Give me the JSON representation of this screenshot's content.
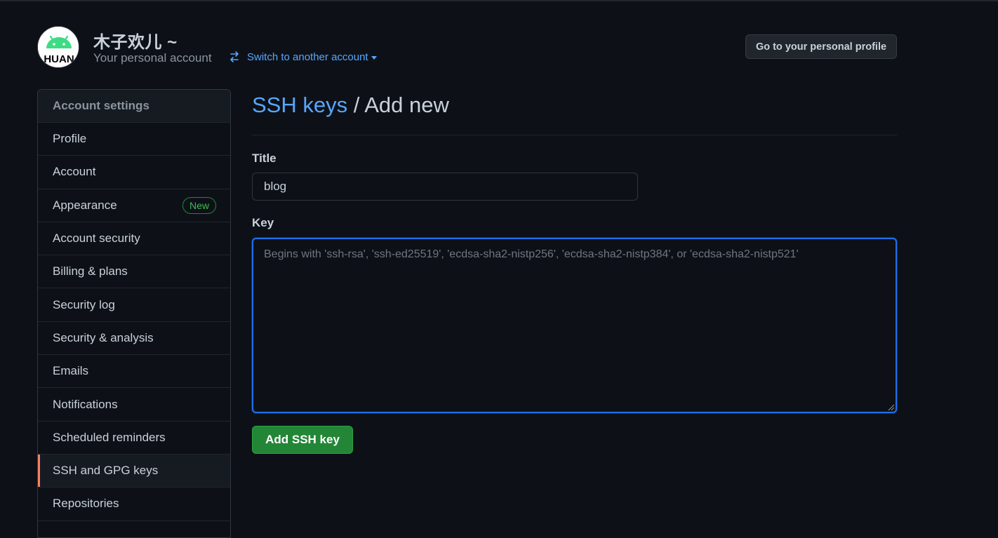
{
  "account": {
    "avatar_text": "HUAN",
    "name": "木子欢儿 ~",
    "subtitle": "Your personal account",
    "switch_label": "Switch to another account",
    "profile_button": "Go to your personal profile"
  },
  "sidebar": {
    "heading": "Account settings",
    "items": [
      {
        "label": "Profile"
      },
      {
        "label": "Account"
      },
      {
        "label": "Appearance",
        "badge": "New"
      },
      {
        "label": "Account security"
      },
      {
        "label": "Billing & plans"
      },
      {
        "label": "Security log"
      },
      {
        "label": "Security & analysis"
      },
      {
        "label": "Emails"
      },
      {
        "label": "Notifications"
      },
      {
        "label": "Scheduled reminders"
      },
      {
        "label": "SSH and GPG keys",
        "selected": true
      },
      {
        "label": "Repositories"
      }
    ]
  },
  "main": {
    "breadcrumb_link": "SSH keys",
    "breadcrumb_rest": " / Add new",
    "title_label": "Title",
    "title_value": "blog",
    "key_label": "Key",
    "key_placeholder": "Begins with 'ssh-rsa', 'ssh-ed25519', 'ecdsa-sha2-nistp256', 'ecdsa-sha2-nistp384', or 'ecdsa-sha2-nistp521'",
    "submit_label": "Add SSH key"
  },
  "colors": {
    "background": "#0d1117",
    "link": "#58a6ff",
    "primary_button": "#238636",
    "selected_accent": "#f78166",
    "focus_border": "#1f6feb"
  }
}
